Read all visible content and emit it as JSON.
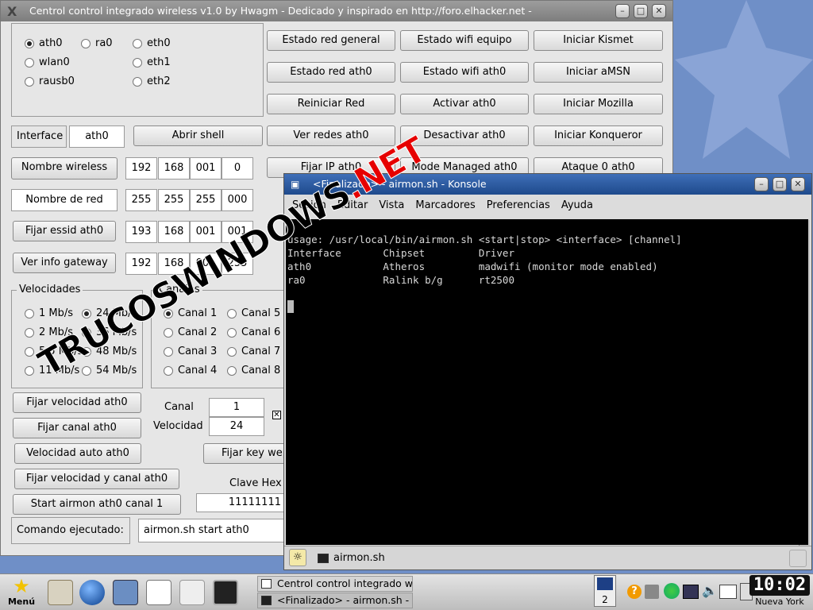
{
  "main_window": {
    "title": "Centrol control integrado wireless v1.0 by Hwagm - Dedicado y inspirado en http://foro.elhacker.net -",
    "interfaces": [
      {
        "label": "ath0",
        "selected": true
      },
      {
        "label": "ra0",
        "selected": false
      },
      {
        "label": "eth0",
        "selected": false
      },
      {
        "label": "wlan0",
        "selected": false
      },
      {
        "label": "eth1",
        "selected": false
      },
      {
        "label": "rausb0",
        "selected": false
      },
      {
        "label": "eth2",
        "selected": false
      }
    ],
    "buttons": {
      "estado_red_general": "Estado red general",
      "estado_wifi_equipo": "Estado wifi equipo",
      "iniciar_kismet": "Iniciar Kismet",
      "estado_red_ath0": "Estado red ath0",
      "estado_wifi_ath0": "Estado wifi ath0",
      "iniciar_amsn": "Iniciar aMSN",
      "reiniciar_red": "Reiniciar Red",
      "activar_ath0": "Activar ath0",
      "iniciar_mozilla": "Iniciar Mozilla",
      "ver_redes_ath0": "Ver redes ath0",
      "desactivar_ath0": "Desactivar ath0",
      "iniciar_konqueror": "Iniciar Konqueror",
      "fijar_ip_ath0": "Fijar IP ath0",
      "mode_managed_ath0": "Mode Managed ath0",
      "ataque_0_ath0": "Ataque 0 ath0",
      "abrir_shell": "Abrir shell",
      "nombre_wireless": "Nombre wireless",
      "nombre_de_red": "Nombre de red",
      "fijar_essid_ath0": "Fijar essid ath0",
      "ver_info_gateway": "Ver info gateway",
      "fijar_velocidad_ath0": "Fijar velocidad ath0",
      "fijar_canal_ath0": "Fijar canal ath0",
      "velocidad_auto_ath0": "Velocidad auto ath0",
      "fijar_velocidad_y_canal_ath0": "Fijar velocidad y canal ath0",
      "start_airmon": "Start airmon ath0 canal 1",
      "fijar_key_wep": "Fijar key wep"
    },
    "interface_label": "Interface",
    "interface_value": "ath0",
    "ip_rows": [
      [
        "192",
        "168",
        "001",
        "0"
      ],
      [
        "255",
        "255",
        "255",
        "000"
      ],
      [
        "193",
        "168",
        "001",
        "001"
      ],
      [
        "192",
        "168",
        "001",
        "255"
      ]
    ],
    "velocidades": {
      "title": "Velocidades",
      "options": [
        {
          "label": "1 Mb/s",
          "selected": false
        },
        {
          "label": "24 Mb/s",
          "selected": true
        },
        {
          "label": "2 Mb/s",
          "selected": false
        },
        {
          "label": "36 Mb/s",
          "selected": false
        },
        {
          "label": "5.5 Mb/s",
          "selected": false
        },
        {
          "label": "48 Mb/s",
          "selected": false
        },
        {
          "label": "11 Mb/s",
          "selected": false
        },
        {
          "label": "54 Mb/s",
          "selected": false
        }
      ]
    },
    "canales": {
      "title": "Canales",
      "options": [
        {
          "label": "Canal 1",
          "selected": true
        },
        {
          "label": "Canal 5",
          "selected": false
        },
        {
          "label": "Canal 2",
          "selected": false
        },
        {
          "label": "Canal 6",
          "selected": false
        },
        {
          "label": "Canal 3",
          "selected": false
        },
        {
          "label": "Canal 7",
          "selected": false
        },
        {
          "label": "Canal 4",
          "selected": false
        },
        {
          "label": "Canal 8",
          "selected": false
        }
      ]
    },
    "canal_label": "Canal",
    "canal_value": "1",
    "velocidad_label": "Velocidad",
    "velocidad_value": "24",
    "clave_hex_label": "Clave Hex",
    "clave_hex_value": "11111111",
    "comando_label": "Comando ejecutado:",
    "comando_value": "airmon.sh start ath0"
  },
  "konsole": {
    "title": "<Finalizado> - airmon.sh - Konsole",
    "menu": [
      "Sesión",
      "Editar",
      "Vista",
      "Marcadores",
      "Preferencias",
      "Ayuda"
    ],
    "lines": [
      "usage: /usr/local/bin/airmon.sh <start|stop> <interface> [channel]",
      "",
      "Interface       Chipset         Driver",
      "",
      "ath0            Atheros         madwifi (monitor mode enabled)",
      "ra0             Ralink b/g      rt2500"
    ],
    "tab_label": "airmon.sh"
  },
  "taskbar": {
    "menu_label": "Menú",
    "tasks": [
      "Centrol control integrado wireless",
      "<Finalizado> - airmon.sh - Konsole"
    ],
    "desktop_number": "2",
    "clock": "10:02",
    "timezone": "Nueva York"
  },
  "watermark": "TRUCOSWINDOWS.NET",
  "colors": {
    "watermark_main": "#000000",
    "watermark_accent": "#e60000",
    "taskbar_bg": "#d0d0d0",
    "desktop_bg": "#6f8fc7"
  }
}
